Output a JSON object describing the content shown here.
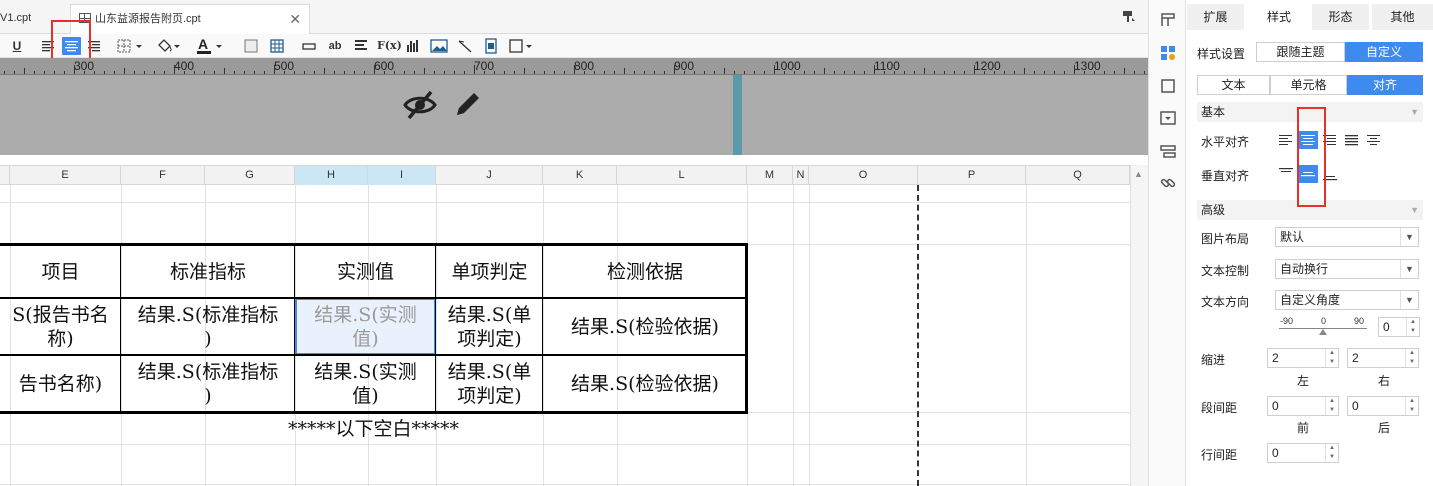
{
  "tabs": {
    "tab1_label": "V1.cpt",
    "tab2_label": "山东益源报告附页.cpt",
    "close_glyph": "✕"
  },
  "toolbar": {
    "underline_label": "U",
    "text_label": "ab",
    "formula_label": "F(x)"
  },
  "ruler": {
    "labels": [
      "300",
      "400",
      "500",
      "600",
      "700",
      "800",
      "900",
      "1000",
      "1100",
      "1200",
      "1300"
    ]
  },
  "columns": [
    "E",
    "F",
    "G",
    "H",
    "I",
    "J",
    "K",
    "L",
    "M",
    "N",
    "O",
    "P",
    "Q"
  ],
  "report": {
    "header": [
      "项目",
      "标准指标",
      "实测值",
      "单项判定",
      "检测依据"
    ],
    "row1": [
      "S(报告书名\n称)",
      "结果.S(标准指标\n)",
      "结果.S(实测\n值)",
      "结果.S(单\n项判定)",
      "结果.S(检验依据)"
    ],
    "row2": [
      "告书名称)",
      "结果.S(标准指标\n)",
      "结果.S(实测\n值)",
      "结果.S(单\n项判定)",
      "结果.S(检验依据)"
    ],
    "footer": "*****以下空白*****"
  },
  "panel": {
    "tabs": [
      "扩展",
      "样式",
      "形态",
      "其他"
    ],
    "style_setting_label": "样式设置",
    "style_follow_theme": "跟随主题",
    "style_custom": "自定义",
    "subtabs": [
      "文本",
      "单元格",
      "对齐"
    ],
    "section_basic": "基本",
    "h_align_label": "水平对齐",
    "v_align_label": "垂直对齐",
    "section_advanced": "高级",
    "image_layout_label": "图片布局",
    "image_layout_value": "默认",
    "text_control_label": "文本控制",
    "text_control_value": "自动换行",
    "text_direction_label": "文本方向",
    "text_direction_value": "自定义角度",
    "angle_min": "-90",
    "angle_mid": "0",
    "angle_max": "90",
    "angle_value": "0",
    "indent_label": "缩进",
    "indent_left_value": "2",
    "indent_right_value": "2",
    "indent_left_sub": "左",
    "indent_right_sub": "右",
    "para_spacing_label": "段间距",
    "para_before_value": "0",
    "para_after_value": "0",
    "para_before_sub": "前",
    "para_after_sub": "后",
    "line_spacing_label": "行间距",
    "line_spacing_value": "0"
  },
  "colors": {
    "accent": "#3d8bef",
    "highlight_box": "#e8302a",
    "selected_cell_border": "#3a8ee6"
  }
}
